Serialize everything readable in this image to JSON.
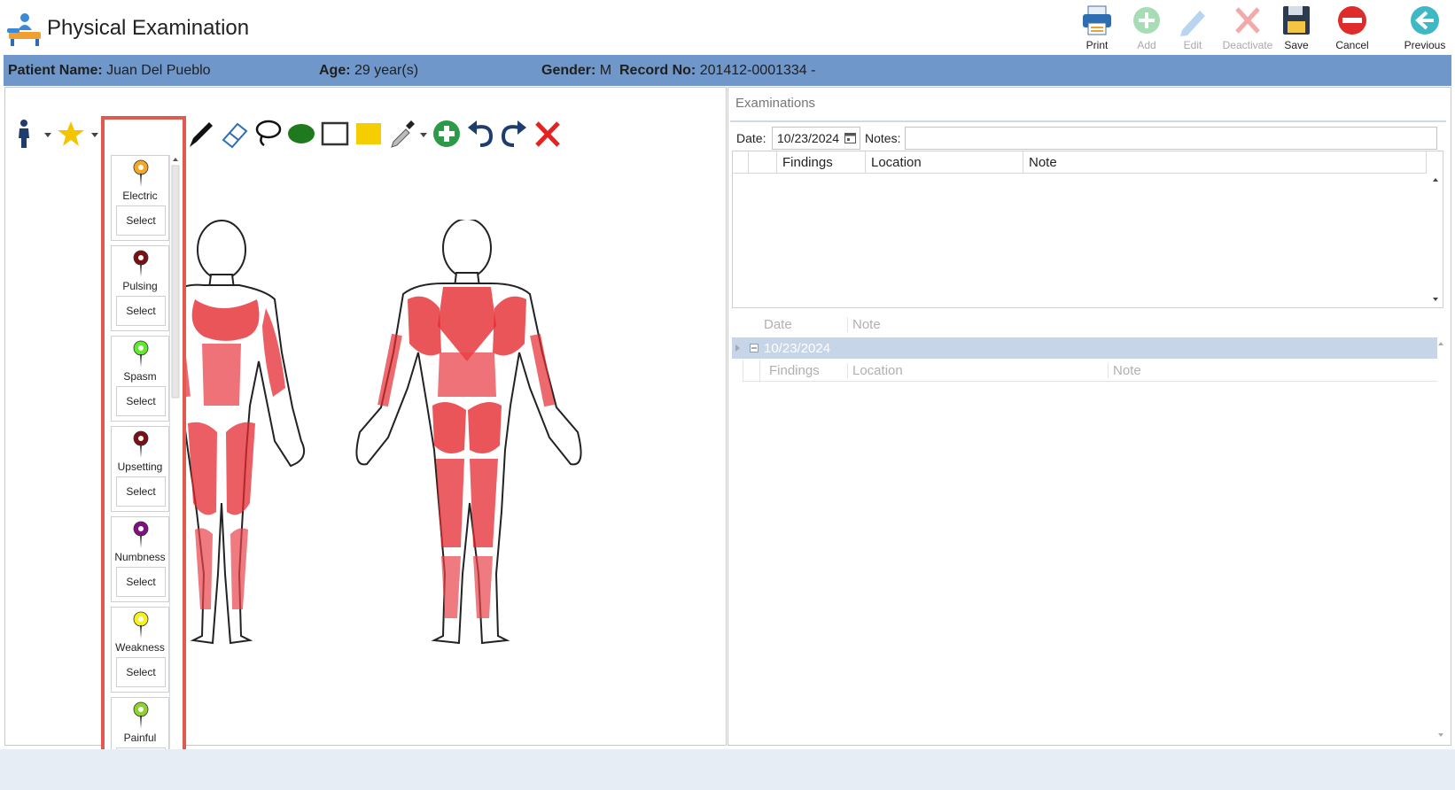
{
  "app": {
    "title": "Physical Examination"
  },
  "toolbar": {
    "print": "Print",
    "add": "Add",
    "edit": "Edit",
    "deactivate": "Deactivate",
    "save": "Save",
    "cancel": "Cancel",
    "previous": "Previous"
  },
  "patient": {
    "name_label": "Patient Name:",
    "name": "Juan Del Pueblo",
    "age_label": "Age:",
    "age": "29 year(s)",
    "gender_label": "Gender:",
    "gender": "M",
    "record_label": "Record No:",
    "record": "201412-0001334 -"
  },
  "pins": [
    {
      "label": "Electric",
      "color": "#f5a623",
      "select": "Select"
    },
    {
      "label": "Pulsing",
      "color": "#7a0f14",
      "select": "Select"
    },
    {
      "label": "Spasm",
      "color": "#5fe82c",
      "select": "Select"
    },
    {
      "label": "Upsetting",
      "color": "#7a0f14",
      "select": "Select"
    },
    {
      "label": "Numbness",
      "color": "#800f80",
      "select": "Select"
    },
    {
      "label": "Weakness",
      "color": "#f7f019",
      "select": "Select"
    },
    {
      "label": "Painful",
      "color": "#8fd12c",
      "select": "Select"
    }
  ],
  "examinations": {
    "title": "Examinations",
    "date_label": "Date:",
    "date_value": "10/23/2024",
    "notes_label": "Notes:",
    "notes_value": "",
    "columns": [
      "Findings",
      "Location",
      "Note"
    ]
  },
  "history": {
    "columns": [
      "Date",
      "Note"
    ],
    "group_date": "10/23/2024",
    "sub_columns": [
      "Findings",
      "Location",
      "Note"
    ]
  }
}
